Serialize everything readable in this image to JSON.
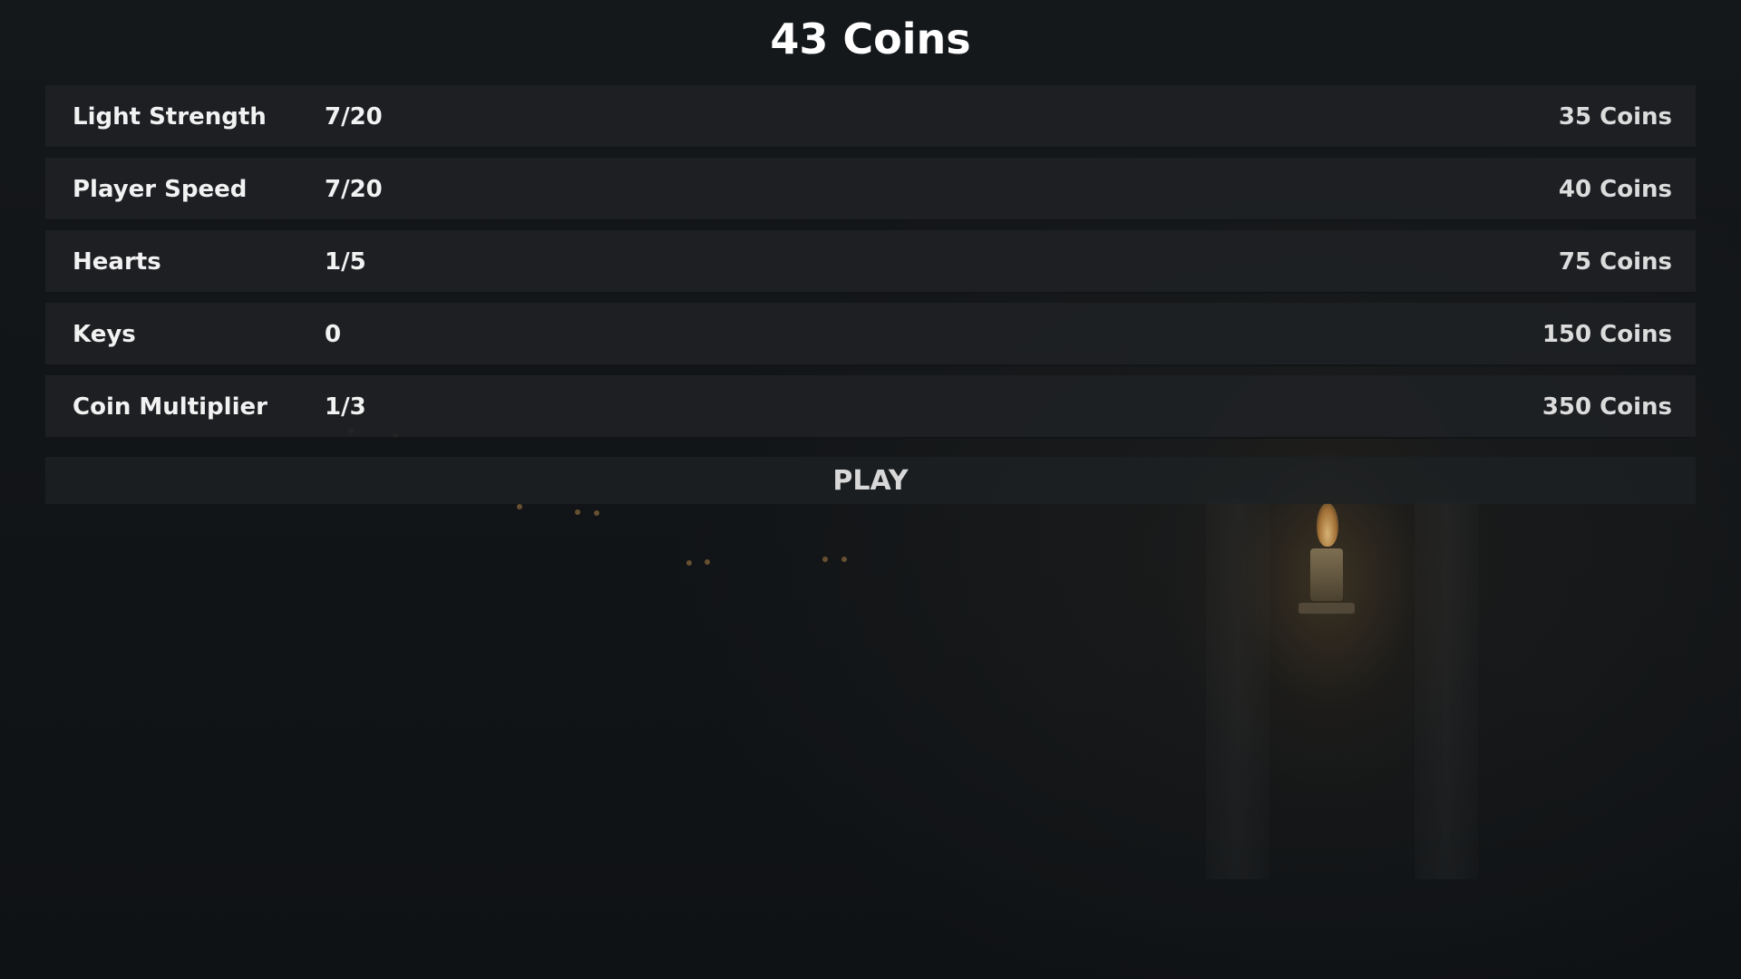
{
  "header": {
    "coins": "43 Coins"
  },
  "upgrades": [
    {
      "name": "Light Strength",
      "level": "7/20",
      "price": "35 Coins"
    },
    {
      "name": "Player Speed",
      "level": "7/20",
      "price": "40 Coins"
    },
    {
      "name": "Hearts",
      "level": "1/5",
      "price": "75 Coins"
    },
    {
      "name": "Keys",
      "level": "0",
      "price": "150 Coins"
    },
    {
      "name": "Coin Multiplier",
      "level": "1/3",
      "price": "350 Coins"
    }
  ],
  "play": {
    "label": "PLAY"
  },
  "colors": {
    "background": "#101316",
    "panel": "#1e2124",
    "text": "#f2f2f2",
    "torch_light": "#e8c080"
  }
}
